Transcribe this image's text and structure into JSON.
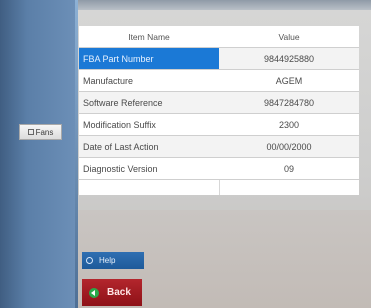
{
  "table": {
    "headers": {
      "name": "Item Name",
      "value": "Value"
    },
    "rows": [
      {
        "name": "FBA Part Number",
        "value": "9844925880"
      },
      {
        "name": "Manufacture",
        "value": "AGEM"
      },
      {
        "name": "Software Reference",
        "value": "9847284780"
      },
      {
        "name": "Modification Suffix",
        "value": "2300"
      },
      {
        "name": "Date of Last Action",
        "value": "00/00/2000"
      },
      {
        "name": "Diagnostic Version",
        "value": "09"
      }
    ],
    "selected_row": 0
  },
  "left_panel": {
    "fans_label": "Fans"
  },
  "buttons": {
    "help_label": "Help",
    "back_label": "Back"
  },
  "colors": {
    "selection": "#1b79d6",
    "left_panel": "#5b7fa8",
    "back_button": "#a41b22",
    "help_button": "#2f6fb2"
  },
  "icons": {
    "fans": "fans-icon",
    "help": "help-icon",
    "back": "back-arrow-icon"
  }
}
